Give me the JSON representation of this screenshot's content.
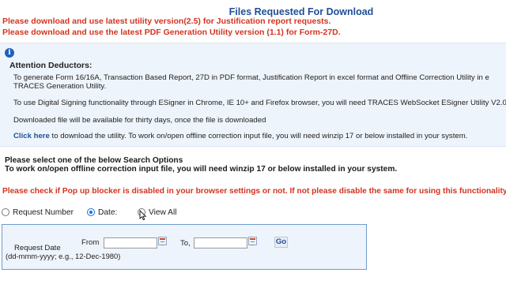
{
  "page": {
    "title": "Files Requested For Download",
    "notice_utility": "Please download and use latest utility version(2.5) for Justification report requests.",
    "notice_pdf": "Please download and use the latest PDF Generation Utility version (1.1) for Form-27D."
  },
  "info": {
    "icon": "info-icon",
    "heading": "Attention Deductors:",
    "line1": "To generate Form 16/16A, Transaction Based Report, 27D in PDF format, Justification Report in excel format and Offline Correction Utility in e",
    "line1b": "TRACES Generation Utility.",
    "line2": "To use Digital Signing functionality through ESigner in Chrome, IE 10+ and Firefox browser, you will need TRACES WebSocket ESigner Utility V2.0.",
    "line3": "Downloaded file will be available for thirty days, once the file is downloaded",
    "click_here": "Click here",
    "line4_rest": " to download the utility. To work on/open offline correction input file, you will need winzip 17 or below installed in your system."
  },
  "search": {
    "heading": "Please select one of the below Search Options",
    "heading2": "To work on/open offline correction input file, you will need winzip 17 or below installed in your system.",
    "popup_warning": "Please check if Pop up blocker is disabled in your browser settings or not. If not please disable the same for using this functionality",
    "options": [
      {
        "label": "Request Number",
        "checked": false
      },
      {
        "label": "Date:",
        "checked": true
      },
      {
        "label": "View All",
        "checked": false
      }
    ],
    "request_date_label": "Request Date",
    "request_date_hint": "(dd-mmm-yyyy; e.g., 12-Dec-1980)",
    "from_label": "From",
    "to_label": "To,",
    "from_value": "",
    "to_value": "",
    "go_label": "Go"
  },
  "colors": {
    "title": "#1f4f96",
    "warning": "#d4331f",
    "panel_bg": "#eef4fb",
    "panel_border": "#6f9ccc"
  }
}
